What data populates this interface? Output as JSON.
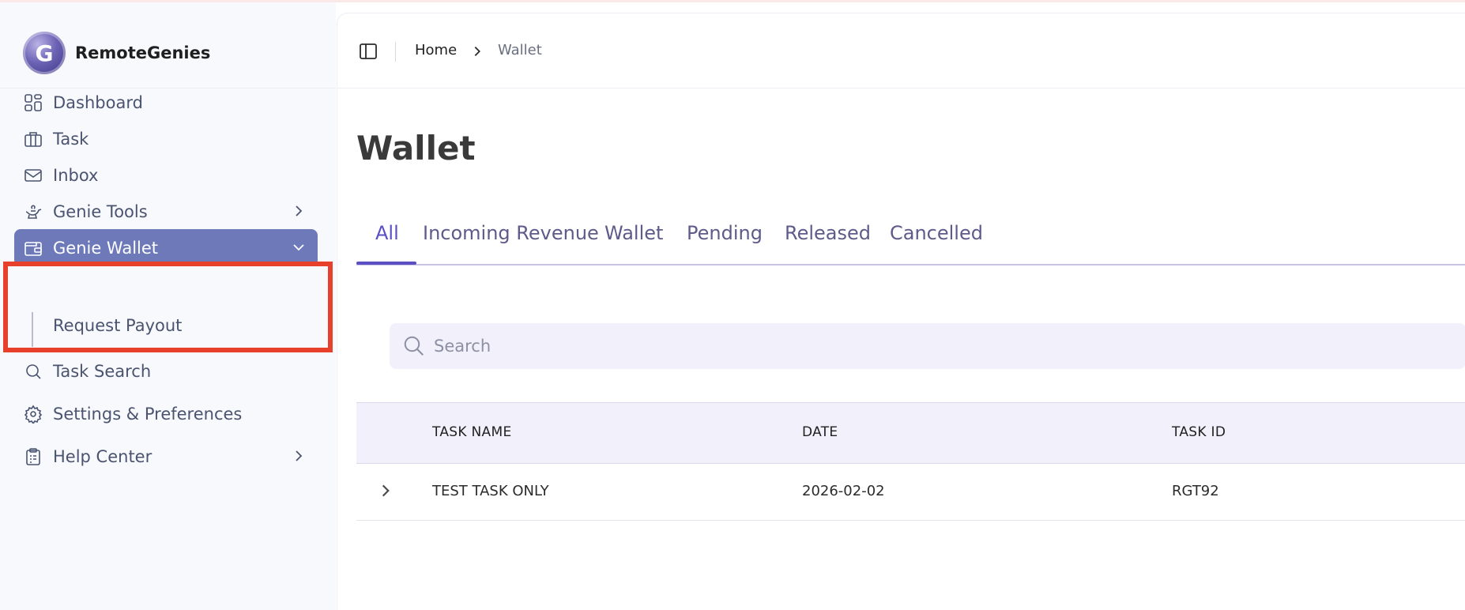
{
  "app": {
    "name": "RemoteGenies",
    "logo_letter": "G"
  },
  "sidebar": {
    "items": [
      {
        "label": "Dashboard",
        "icon": "dashboard-grid-icon"
      },
      {
        "label": "Task",
        "icon": "briefcase-icon"
      },
      {
        "label": "Inbox",
        "icon": "mail-icon"
      },
      {
        "label": "Genie Tools",
        "icon": "genie-lamp-icon",
        "chevron": "chevron-right-icon"
      },
      {
        "label": "Genie Wallet",
        "icon": "wallet-icon",
        "chevron": "chevron-down-icon",
        "active": true
      },
      {
        "label": "Task Search",
        "icon": "search-icon"
      },
      {
        "label": "Settings & Preferences",
        "icon": "gear-icon"
      },
      {
        "label": "Help Center",
        "icon": "clipboard-icon",
        "chevron": "chevron-right-icon"
      }
    ],
    "sub_items": [
      {
        "label": "Request Payout"
      }
    ]
  },
  "breadcrumb": {
    "home": "Home",
    "current": "Wallet"
  },
  "page": {
    "title": "Wallet"
  },
  "tabs": [
    {
      "label": "All",
      "active": true
    },
    {
      "label": "Incoming Revenue"
    },
    {
      "label": "Wallet"
    },
    {
      "label": "Pending"
    },
    {
      "label": "Released"
    },
    {
      "label": "Cancelled"
    }
  ],
  "search": {
    "placeholder": "Search",
    "value": ""
  },
  "table": {
    "columns": [
      "TASK NAME",
      "DATE",
      "TASK ID"
    ],
    "rows": [
      {
        "task_name": "TEST TASK ONLY",
        "date": "2026-02-02",
        "task_id": "RGT92"
      }
    ]
  },
  "colors": {
    "active_nav": "#6e79ba",
    "accent": "#5b4fc4",
    "highlight": "#e8412b",
    "sidebar_bg": "#f8f9fc"
  }
}
